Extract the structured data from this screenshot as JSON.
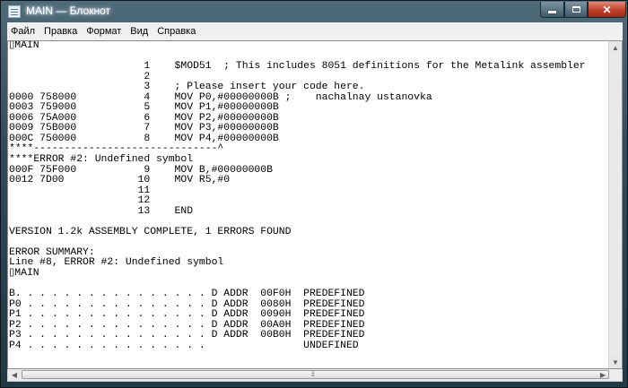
{
  "window": {
    "title": "MAIN — Блокнот"
  },
  "controls": {
    "minimize": "minimize",
    "maximize": "maximize",
    "close": "✕"
  },
  "menu": [
    "Файл",
    "Правка",
    "Формат",
    "Вид",
    "Справка"
  ],
  "document": {
    "lines": [
      "▯MAIN",
      "",
      "                      1    $MOD51  ; This includes 8051 definitions for the Metalink assembler",
      "                      2",
      "                      3    ; Please insert your code here.",
      "0000 758000           4    MOV P0,#00000000B ;    nachalnay ustanovka",
      "0003 759000           5    MOV P1,#00000000B",
      "0006 75A000           6    MOV P2,#00000000B",
      "0009 75B000           7    MOV P3,#00000000B",
      "000C 750000           8    MOV P4,#00000000B",
      "****------------------------------^",
      "****ERROR #2: Undefined symbol",
      "000F 75F000           9    MOV B,#00000000B",
      "0012 7D00            10    MOV R5,#0",
      "                     11",
      "                     12",
      "                     13    END",
      "",
      "VERSION 1.2k ASSEMBLY COMPLETE, 1 ERRORS FOUND",
      "",
      "ERROR SUMMARY:",
      "Line #8, ERROR #2: Undefined symbol",
      "▯MAIN",
      "",
      "B. . . . . . . . . . . . . . . . D ADDR  00F0H  PREDEFINED",
      "P0 . . . . . . . . . . . . . . . D ADDR  0080H  PREDEFINED",
      "P1 . . . . . . . . . . . . . . . D ADDR  0090H  PREDEFINED",
      "P2 . . . . . . . . . . . . . . . D ADDR  00A0H  PREDEFINED",
      "P3 . . . . . . . . . . . . . . . D ADDR  00B0H  PREDEFINED",
      "P4 . . . . . . . . . . . . . . .                UNDEFINED"
    ]
  },
  "colors": {
    "frame": "#2f4a58",
    "close_button": "#c1402a",
    "editor_bg": "#ffffff",
    "menubar_bg": "#f0f0f0"
  },
  "icons": {
    "app": "notepad-icon",
    "scroll_up": "arrow-up-icon",
    "scroll_down": "arrow-down-icon",
    "scroll_left": "arrow-left-icon",
    "scroll_right": "arrow-right-icon"
  }
}
